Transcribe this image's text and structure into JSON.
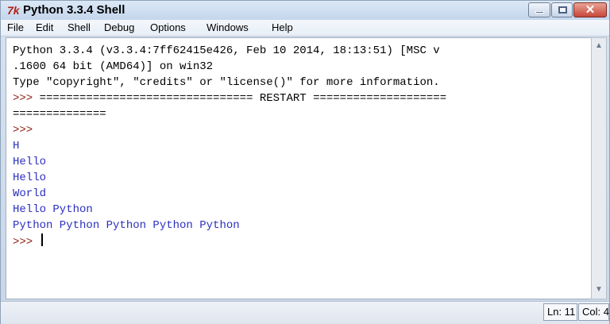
{
  "window": {
    "title": "Python 3.3.4 Shell",
    "icon": "tk-feather-icon"
  },
  "menu": {
    "items": [
      "File",
      "Edit",
      "Shell",
      "Debug",
      "Options",
      "Windows",
      "Help"
    ]
  },
  "shell": {
    "lines": [
      {
        "type": "text",
        "text": "Python 3.3.4 (v3.3.4:7ff62415e426, Feb 10 2014, 18:13:51) [MSC v"
      },
      {
        "type": "text",
        "text": ".1600 64 bit (AMD64)] on win32"
      },
      {
        "type": "text",
        "text": "Type \"copyright\", \"credits\" or \"license()\" for more information."
      },
      {
        "type": "prompt",
        "prompt": ">>> ",
        "text": "================================ RESTART ===================="
      },
      {
        "type": "text",
        "text": "=============="
      },
      {
        "type": "prompt",
        "prompt": ">>>",
        "text": ""
      },
      {
        "type": "output",
        "text": "H"
      },
      {
        "type": "output",
        "text": "Hello"
      },
      {
        "type": "output",
        "text": "Hello"
      },
      {
        "type": "output",
        "text": "World"
      },
      {
        "type": "output",
        "text": "Hello Python"
      },
      {
        "type": "output",
        "text": "Python Python Python Python Python"
      },
      {
        "type": "prompt",
        "prompt": ">>> ",
        "text": "",
        "cursor": true
      }
    ]
  },
  "status": {
    "ln": "Ln: 11",
    "col": "Col: 4"
  },
  "colors": {
    "prompt": "#8a1b12",
    "output": "#2b2fbf",
    "text": "#000000"
  }
}
